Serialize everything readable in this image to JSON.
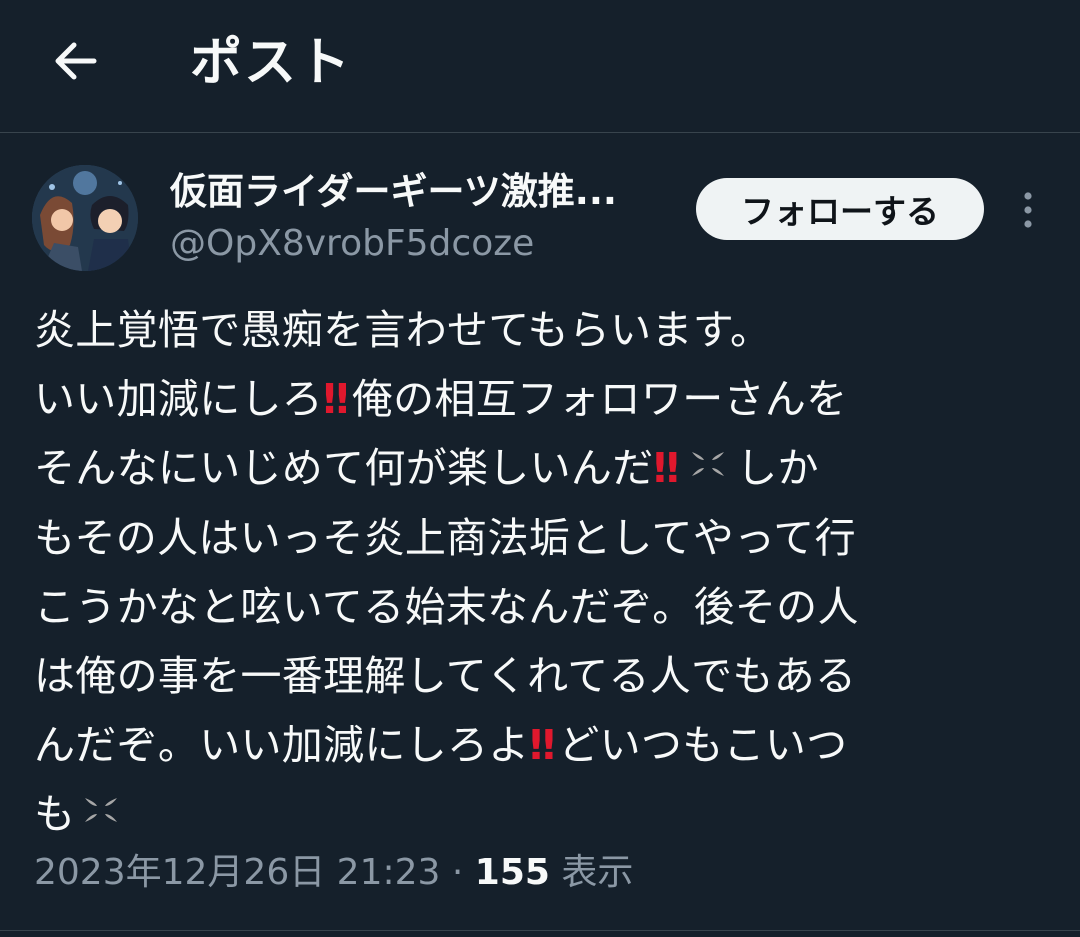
{
  "header": {
    "title": "ポスト",
    "back_icon": "arrow-left-icon"
  },
  "author": {
    "display_name": "仮面ライダーギーツ激推...",
    "handle": "@OpX8vrobF5dcoze",
    "follow_label": "フォローする"
  },
  "tweet": {
    "lines": [
      {
        "t1": "炎上覚悟で愚痴を言わせてもらいます。"
      },
      {
        "t1": "いい加減にしろ",
        "e1": "‼",
        "t2": "俺の相互フォロワーさんを"
      },
      {
        "t1": "そんなにいじめて何が楽しいんだ",
        "e1": "‼",
        "t2": "しか"
      },
      {
        "t1": "もその人はいっそ炎上商法垢としてやって行"
      },
      {
        "t1": "こうかなと呟いてる始末なんだぞ。後その人"
      },
      {
        "t1": "は俺の事を一番理解してくれてる人でもある"
      },
      {
        "t1": "んだぞ。いい加減にしろよ",
        "e1": "‼",
        "t2": "どいつもこいつ"
      },
      {
        "t1": "も"
      }
    ]
  },
  "meta": {
    "datetime": "2023年12月26日 21:23",
    "separator": "·",
    "views_count": "155",
    "views_label": "表示"
  },
  "colors": {
    "background": "#15202b",
    "text": "#f7f9f9",
    "secondary_text": "#8b98a5",
    "divider": "#38444d",
    "emoji_red": "#e0182d"
  }
}
